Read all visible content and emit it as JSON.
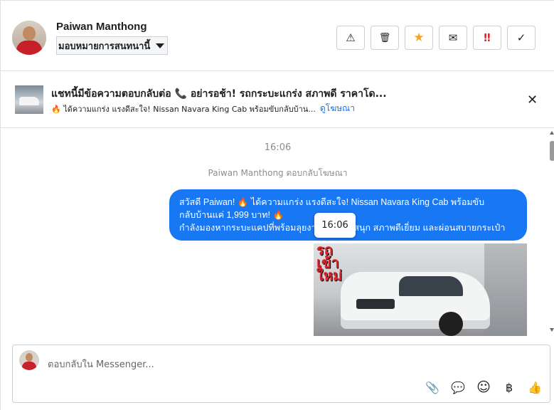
{
  "header": {
    "contact_name": "Paiwan Manthong",
    "assign_label": "มอบหมายการสนทนานี้",
    "actions": [
      {
        "name": "mark-spam-button",
        "icon": "warning-icon",
        "glyph": "⚠"
      },
      {
        "name": "delete-button",
        "icon": "trash-icon",
        "glyph": "🗑"
      },
      {
        "name": "star-button",
        "icon": "star-icon",
        "glyph": "★",
        "color": "#f5a623"
      },
      {
        "name": "mark-unread-button",
        "icon": "envelope-icon",
        "glyph": "✉"
      },
      {
        "name": "follow-up-button",
        "icon": "exclamation-icon",
        "glyph": "‼",
        "color": "#e0242d"
      },
      {
        "name": "mark-done-button",
        "icon": "checkmark-icon",
        "glyph": "✓"
      }
    ]
  },
  "ad": {
    "title": "แชทนี้มีข้อความตอบกลับต่อ 📞 อย่ารอช้า! รถกระบะแกร่ง สภาพดี ราคาโด...",
    "subtitle": "🔥 ได้ความแกร่ง แรงดีสะใจ! Nissan Navara King Cab พร้อมขับกลับบ้าน...",
    "link": "ดูโฆษณา",
    "close_glyph": "✕"
  },
  "chat": {
    "time_separator": "16:06",
    "system_message": "Paiwan Manthong ตอบกลับโฆษณา",
    "bubble_lines": [
      "สวัสดี Paiwan! 🔥 ได้ความแกร่ง แรงดีสะใจ! Nissan Navara King Cab พร้อมขับ",
      "กลับบ้านแค่ 1,999 บาท! 🔥",
      "กำลังมองหากระบะแคปที่พร้อมลุยงานหนัก ขับสนุก สภาพดีเยี่ยม และผ่อนสบายกระเป๋า"
    ],
    "tooltip_time": "16:06",
    "photo_logo_lines": [
      "รถ",
      "เข้า",
      "ใหม่"
    ]
  },
  "composer": {
    "placeholder": "ตอบกลับใน Messenger...",
    "tools": [
      {
        "name": "attach-button",
        "icon": "paperclip-icon",
        "glyph": "📎"
      },
      {
        "name": "saved-replies-button",
        "icon": "chat-bubble-icon",
        "glyph": "💬"
      },
      {
        "name": "emoji-button",
        "icon": "smiley-icon",
        "glyph": "☺"
      },
      {
        "name": "payment-button",
        "icon": "baht-icon",
        "glyph": "฿"
      },
      {
        "name": "like-button",
        "icon": "thumbs-up-icon",
        "glyph": "👍"
      }
    ]
  },
  "colors": {
    "accent": "#1877f2",
    "link": "#1a73e8",
    "star": "#f5a623",
    "alert": "#e0242d"
  }
}
